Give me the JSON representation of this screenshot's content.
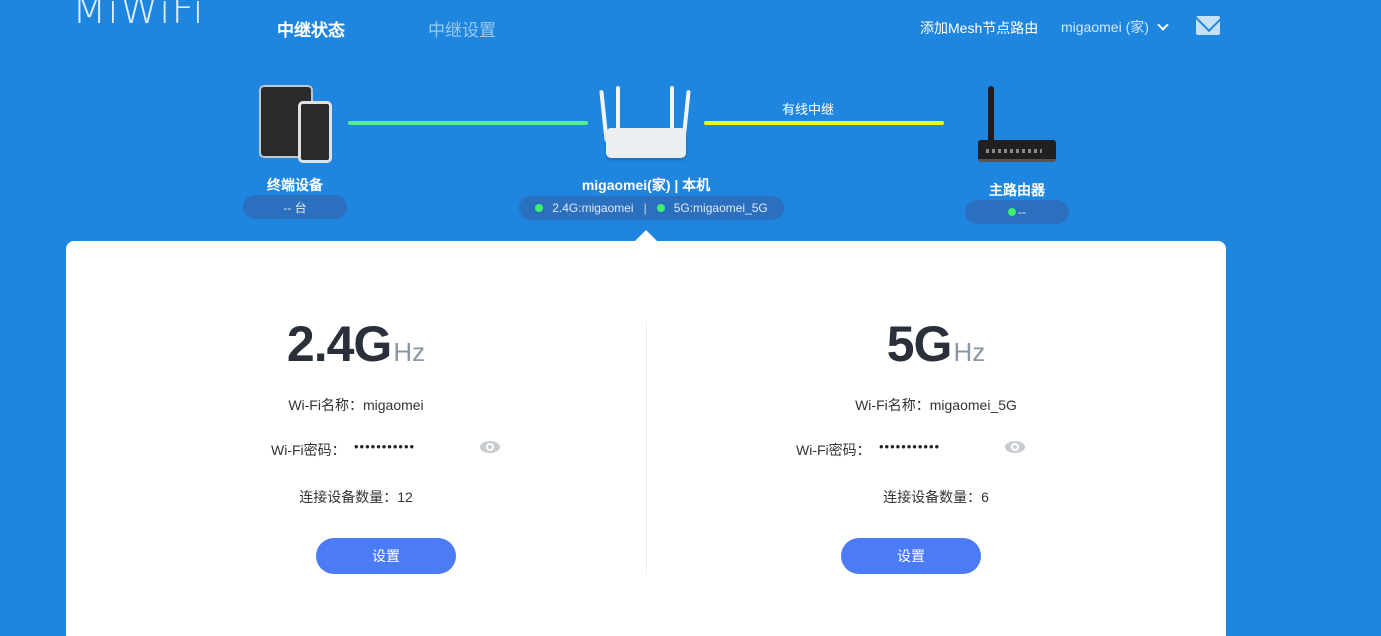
{
  "header": {
    "logo": "MiWiFi",
    "tabs": [
      {
        "label": "中继状态",
        "active": true
      },
      {
        "label": "中继设置",
        "active": false
      }
    ],
    "add_mesh": "添加Mesh节点路由",
    "user": "migaomei (家)",
    "mail_icon": "mail-icon"
  },
  "topology": {
    "terminal": {
      "label": "终端设备",
      "count": "-- 台"
    },
    "this_router": {
      "label": "migaomei(家) | 本机",
      "band_24": "2.4G:migaomei",
      "band_5": "5G:migaomei_5G",
      "separator": "|"
    },
    "link_label": "有线中继",
    "main_router": {
      "label": "主路由器",
      "status": "--"
    },
    "colors": {
      "client_link": "#58f08a",
      "wired_link": "#f2f525",
      "status_dot": "#3df06d"
    }
  },
  "bands": [
    {
      "freq": "2.4G",
      "unit": "Hz",
      "ssid_label": "Wi-Fi名称：",
      "ssid": "migaomei",
      "pw_label": "Wi-Fi密码：",
      "pw": "•••••••••••",
      "count_label": "连接设备数量：",
      "count": "12",
      "button": "设置"
    },
    {
      "freq": "5G",
      "unit": "Hz",
      "ssid_label": "Wi-Fi名称：",
      "ssid": "migaomei_5G",
      "pw_label": "Wi-Fi密码：",
      "pw": "•••••••••••",
      "count_label": "连接设备数量：",
      "count": "6",
      "button": "设置"
    }
  ],
  "accent": "#4b7bf5",
  "background": "#1f86e0"
}
